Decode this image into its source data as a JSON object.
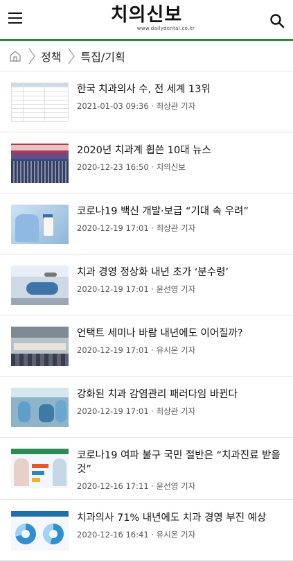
{
  "header": {
    "logo_text": "치의신보",
    "logo_sub": "www.dailydental.co.kr",
    "menu_icon": "hamburger-menu-icon",
    "search_icon": "search-icon",
    "accent_color": "#2e8b2e"
  },
  "breadcrumb": {
    "home_icon": "home-icon",
    "items": [
      "정책",
      "특집/기획"
    ]
  },
  "articles": [
    {
      "title": "한국 치과의사 수, 전 세계 13위",
      "date": "2021-01-03 09:36",
      "author": "최상관 기자",
      "thumb": "ranking-table"
    },
    {
      "title": "2020년 치과계 휩쓴 10대 뉴스",
      "date": "2020-12-23 16:50",
      "author": "치의신보",
      "thumb": "auditorium"
    },
    {
      "title": "코로나19 백신 개발·보급 “기대 속 우려”",
      "date": "2020-12-19 17:01",
      "author": "최상관 기자",
      "thumb": "vaccine"
    },
    {
      "title": "치과 경영 정상화 내년 초가 ‘분수령’",
      "date": "2020-12-19 17:01",
      "author": "윤선영 기자",
      "thumb": "dental-chair"
    },
    {
      "title": "언택트 세미나 바람 내년에도 이어질까?",
      "date": "2020-12-19 17:01",
      "author": "유시온 기자",
      "thumb": "seminar"
    },
    {
      "title": "강화된 치과 감염관리 패러다임 바뀐다",
      "date": "2020-12-19 17:01",
      "author": "최상관 기자",
      "thumb": "infection-control"
    },
    {
      "title": "코로나19 여파 불구 국민 절반은 “치과진료 받을 것”",
      "date": "2020-12-16 17:11",
      "author": "윤선영 기자",
      "thumb": "survey"
    },
    {
      "title": "치과의사 71% 내년에도 치과 경영 부진 예상",
      "date": "2020-12-16 16:41",
      "author": "유시온 기자",
      "thumb": "donut-chart"
    }
  ]
}
